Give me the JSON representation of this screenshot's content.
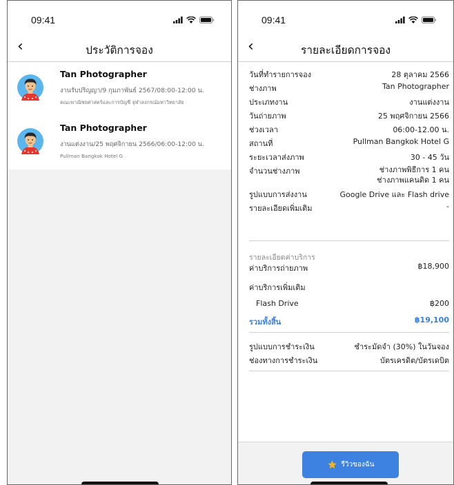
{
  "status_bar": {
    "time": "09:41"
  },
  "history_screen": {
    "title": "ประวัติการจอง",
    "items": [
      {
        "name": "Tan Photographer",
        "description": "งานรับปริญญา/9 กุมภาพันธ์ 2567/08:00-12:00 น.",
        "location": "คณะพาณิชยศาสตร์และการบัญชี จุฬาลงกรณ์มหาวิทยาลัย"
      },
      {
        "name": "Tan Photographer",
        "description": "งานแต่งงาน/25 พฤศจิกายน 2566/06:00-12:00 น.",
        "location": "Pullman Bangkok Hotel G"
      }
    ]
  },
  "detail_screen": {
    "title": "รายละเอียดการจอง",
    "rows": [
      {
        "label": "วันที่ทำรายการจอง",
        "value": "28 ตุลาคม 2566"
      },
      {
        "label": "ช่างภาพ",
        "value": "Tan Photographer"
      },
      {
        "label": "ประเภทงาน",
        "value": "งานแต่งงาน"
      },
      {
        "label": "วันถ่ายภาพ",
        "value": "25 พฤศจิกายน 2566"
      },
      {
        "label": "ช่วงเวลา",
        "value": "06:00-12.00 น."
      },
      {
        "label": "สถานที่",
        "value": "Pullman Bangkok Hotel G"
      },
      {
        "label": "ระยะเวลาส่งภาพ",
        "value": "30 - 45 วัน"
      }
    ],
    "photographers_row": {
      "label": "จำนวนช่างภาพ",
      "value_line1": "ช่างภาพพิธีการ 1 คน",
      "value_line2": "ช่างภาพแคนดิด 1 คน"
    },
    "rows_after": [
      {
        "label": "รูปแบบการส่งงาน",
        "value": "Google Drive และ Flash drive"
      },
      {
        "label": "รายละเอียดเพิ่มเติม",
        "value": "-"
      }
    ],
    "service": {
      "section_title": "รายละเอียดค่าบริการ",
      "photo_fee_label": "ค่าบริการถ่ายภาพ",
      "photo_fee_value": "฿18,900",
      "extra_label": "ค่าบริการเพิ่มเติม",
      "extra_item_label": "Flash Drive",
      "extra_item_value": "฿200",
      "total_label": "รวมทั้งสิ้น",
      "total_value": "฿19,100"
    },
    "payment": {
      "method_label": "รูปแบบการชำระเงิน",
      "method_value": "ชำระมัดจำ (30%) ในวันจอง",
      "channel_label": "ช่องทางการชำระเงิน",
      "channel_value": "บัตรเครดิต/บัตรเดบิต"
    },
    "review_button": {
      "label": "รีวิวของฉัน",
      "icon": "star-icon"
    }
  },
  "colors": {
    "accent": "#3d82e0",
    "total_text": "#3b7fd9",
    "star": "#f6b31b"
  }
}
